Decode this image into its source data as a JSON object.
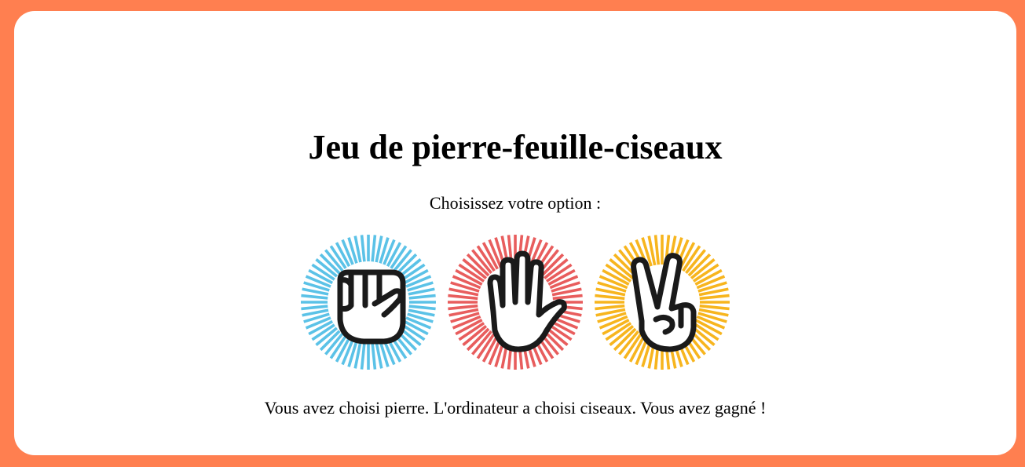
{
  "game": {
    "title": "Jeu de pierre-feuille-ciseaux",
    "prompt": "Choisissez votre option :",
    "result": "Vous avez choisi pierre. L'ordinateur a choisi ciseaux. Vous avez gagné !"
  },
  "choices": [
    {
      "id": "pierre",
      "icon": "rock-fist-icon",
      "color": "#5BC2E7"
    },
    {
      "id": "feuille",
      "icon": "paper-hand-icon",
      "color": "#E85D5D"
    },
    {
      "id": "ciseaux",
      "icon": "scissors-hand-icon",
      "color": "#F7B51E"
    }
  ],
  "colors": {
    "background": "#FF7F50",
    "card": "#FFFFFF"
  }
}
